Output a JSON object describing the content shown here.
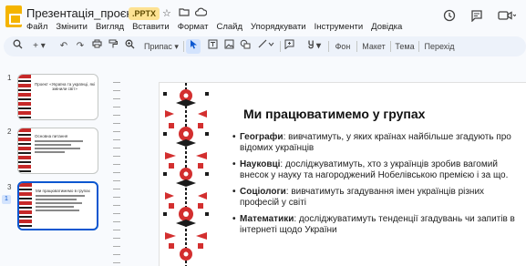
{
  "title_bar": {
    "document_title": "Презентація_проєкту",
    "file_badge": ".PPTX",
    "star_icon": "star-icon",
    "move_icon": "folder-icon",
    "cloud_icon": "cloud-icon"
  },
  "menu": [
    "Файл",
    "Змінити",
    "Вигляд",
    "Вставити",
    "Формат",
    "Слайд",
    "Упорядкувати",
    "Інструменти",
    "Довідка"
  ],
  "header_icons": [
    "history-icon",
    "comments-icon",
    "meet-icon"
  ],
  "toolbar": {
    "zoom_label": "Припас",
    "background_label": "Фон",
    "layout_label": "Макет",
    "theme_label": "Тема",
    "transition_label": "Перехід",
    "icons": [
      "search-icon",
      "new-slide-icon",
      "undo-icon",
      "redo-icon",
      "print-icon",
      "paint-format-icon",
      "zoom-icon",
      "select-icon",
      "text-box-icon",
      "image-icon",
      "shape-icon",
      "line-icon",
      "comment-icon",
      "input-tools-icon"
    ]
  },
  "filmstrip": {
    "slides": [
      {
        "number": "1",
        "text": "Проект «Україна та українці, які змінили світ»"
      },
      {
        "number": "2",
        "text": "Основна питання"
      },
      {
        "number": "3",
        "text": "Ми працюватимемо в групах"
      }
    ],
    "current_indicator": "1"
  },
  "slide": {
    "title": "Ми працюватимемо у групах",
    "bullets": [
      {
        "term": "Географи",
        "text": ": вивчатимуть, у яких країнах найбільше згадують про відомих українців"
      },
      {
        "term": "Науковці",
        "text": ": досліджуватимуть, хто з українців зробив вагомий внесок у науку та нагороджений Нобелівською премією і за що."
      },
      {
        "term": "Соціологи",
        "text": ": вивчатимуть згадування імен українців різних професій у світі"
      },
      {
        "term": "Математики",
        "text": ": досліджуватимуть тенденції згадувань чи запитів в інтернеті щодо України"
      }
    ]
  },
  "colors": {
    "accent": "#0b57d0",
    "badge_bg": "#fde293",
    "ornament_red": "#d32f2f",
    "ornament_black": "#1b1b1b"
  }
}
